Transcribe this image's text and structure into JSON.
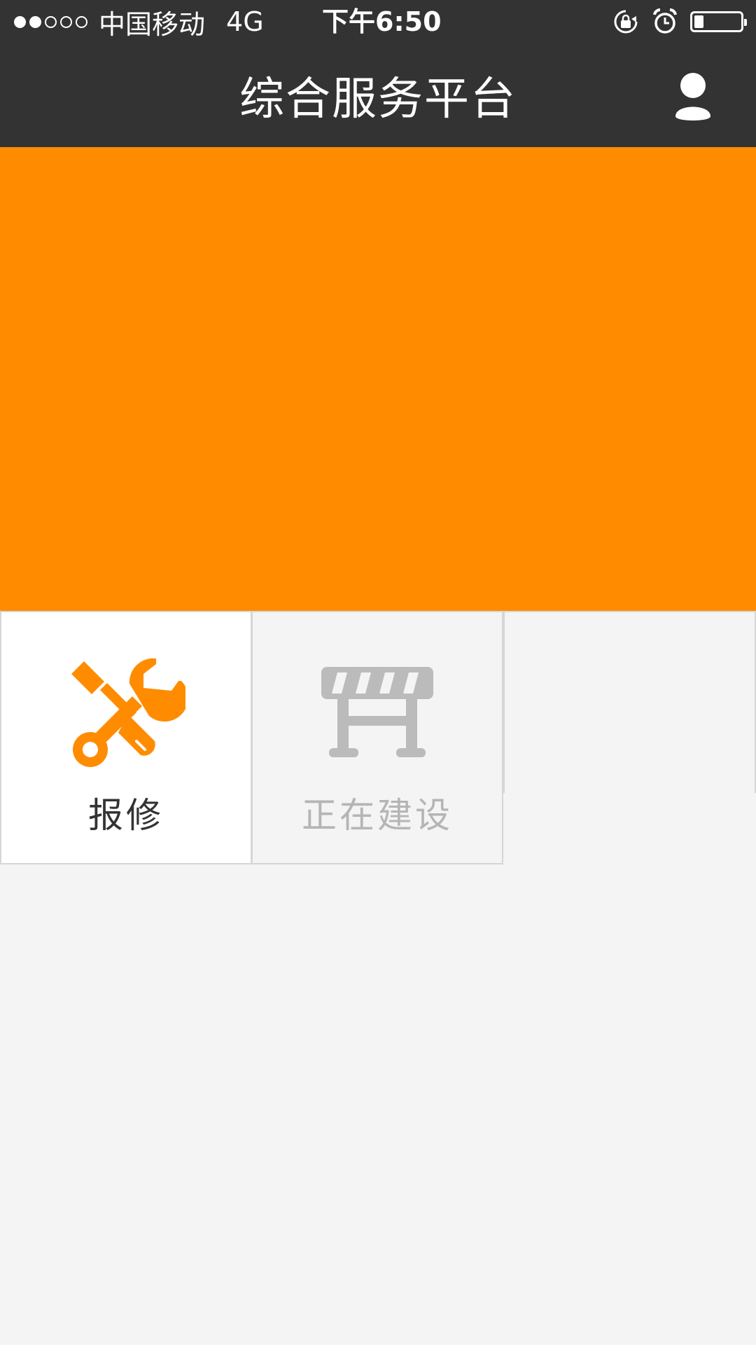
{
  "status_bar": {
    "signal_dots_filled": 2,
    "signal_dots_total": 5,
    "carrier": "中国移动",
    "network": "4G",
    "time": "下午6:50",
    "icons": [
      "rotation-lock-icon",
      "alarm-icon",
      "battery-icon"
    ],
    "battery_level": 0.2
  },
  "nav": {
    "title": "综合服务平台",
    "profile_icon": "user-icon"
  },
  "banner": {
    "color": "#ff8c00"
  },
  "grid": {
    "items": [
      {
        "label": "报修",
        "icon": "wrench-screwdriver-icon",
        "icon_color": "#ff8c00",
        "label_color": "#333333"
      },
      {
        "label": "正在建设",
        "icon": "roadblock-icon",
        "icon_color": "#bbbbbb",
        "label_color": "#b5b5b5"
      }
    ]
  },
  "colors": {
    "header_bg": "#333333",
    "accent": "#ff8c00",
    "page_bg": "#f4f4f4"
  }
}
